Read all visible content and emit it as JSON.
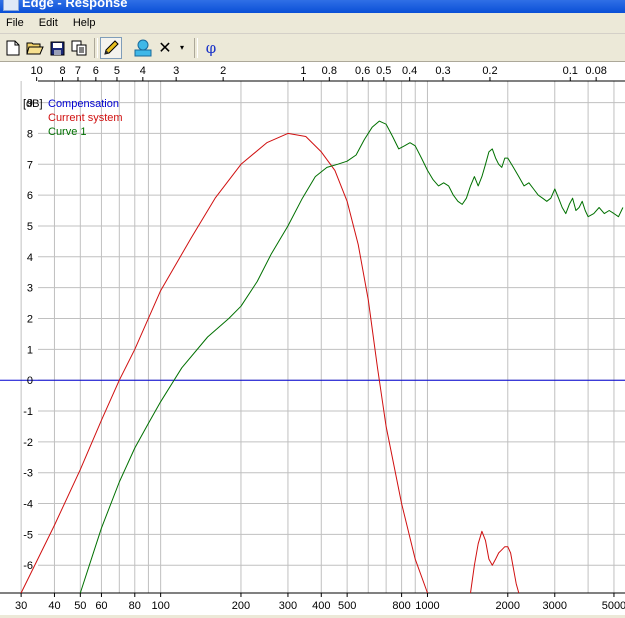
{
  "window": {
    "title": "Edge - Response"
  },
  "menu": {
    "file": "File",
    "edit": "Edit",
    "help": "Help"
  },
  "toolbar": {
    "new": "new-document-icon",
    "open": "open-folder-icon",
    "save": "save-disk-icon",
    "copy": "copy-icon",
    "pen": "pen-icon",
    "stamp": "stamp-icon",
    "delete_symbol": "✕",
    "dropdown_symbol": "▾",
    "phase_symbol": "φ"
  },
  "colors": {
    "compensation": "#0000d0",
    "current_system": "#d01010",
    "curve1": "#007000",
    "grid": "#c0c0c0"
  },
  "chart_data": {
    "type": "line",
    "x_scale": "log",
    "xlim": [
      25,
      5500
    ],
    "ylim": [
      -6.9,
      9.7
    ],
    "ylabel": "[dB]",
    "y_ticks": [
      9,
      8,
      7,
      6,
      5,
      4,
      3,
      2,
      1,
      0,
      -1,
      -2,
      -3,
      -4,
      -5,
      -6
    ],
    "x_ticks_bottom": [
      30,
      40,
      50,
      60,
      80,
      100,
      200,
      300,
      400,
      500,
      800,
      1000,
      2000,
      3000,
      5000
    ],
    "x_tick_labels_bottom": [
      "30",
      "40",
      "50",
      "60",
      "80",
      "100",
      "200",
      "300",
      "400",
      "500",
      "800",
      "1000",
      "2000",
      "3000",
      "5000"
    ],
    "top_axis_unit": "wavelength (m)",
    "top_ticks": [
      10,
      8,
      7,
      6,
      5,
      4,
      3,
      2,
      1,
      0.8,
      0.6,
      0.5,
      0.4,
      0.3,
      0.2,
      0.1,
      0.08
    ],
    "top_tick_labels": [
      "10",
      "8",
      "7",
      "6",
      "5",
      "4",
      "3",
      "2",
      "1",
      "0.8",
      "0.6",
      "0.5",
      "0.4",
      "0.3",
      "0.2",
      "0.1",
      "0.08"
    ],
    "series": [
      {
        "name": "Compensation",
        "color": "#0000d0",
        "x": [
          25,
          5500
        ],
        "y": [
          0,
          0
        ]
      },
      {
        "name": "Current system",
        "color": "#d01010",
        "x": [
          30,
          40,
          50,
          60,
          70,
          80,
          100,
          130,
          160,
          200,
          250,
          300,
          350,
          400,
          450,
          500,
          550,
          600,
          650,
          700,
          800,
          900,
          1000
        ],
        "y": [
          -7,
          -4.7,
          -2.9,
          -1.3,
          0,
          1.0,
          2.9,
          4.6,
          5.9,
          7.0,
          7.7,
          8.0,
          7.9,
          7.4,
          6.8,
          5.8,
          4.4,
          2.6,
          0.4,
          -1.5,
          -4.0,
          -5.8,
          -7
        ]
      },
      {
        "name": "Current system",
        "color": "#d01010",
        "x": [
          1450,
          1500,
          1550,
          1600,
          1650,
          1700,
          1750,
          1800,
          1850,
          1900,
          1950,
          2000,
          2050,
          2100,
          2150,
          2200
        ],
        "y": [
          -7,
          -6.0,
          -5.3,
          -4.9,
          -5.2,
          -5.8,
          -6.0,
          -5.8,
          -5.6,
          -5.5,
          -5.4,
          -5.4,
          -5.6,
          -6.1,
          -6.6,
          -7
        ]
      },
      {
        "name": "Curve 1",
        "color": "#007000",
        "x": [
          50,
          60,
          70,
          80,
          90,
          100,
          120,
          150,
          180,
          200,
          230,
          260,
          300,
          340,
          380,
          420,
          460,
          500,
          540,
          580,
          620,
          660,
          700,
          740,
          780,
          820,
          860,
          900,
          950,
          1000,
          1050,
          1100,
          1150,
          1200,
          1250,
          1300,
          1350,
          1400,
          1450,
          1500,
          1550,
          1600,
          1650,
          1700,
          1750,
          1800,
          1850,
          1900,
          1950,
          2000,
          2100,
          2200,
          2300,
          2400,
          2500,
          2600,
          2700,
          2800,
          2900,
          3000,
          3100,
          3200,
          3300,
          3400,
          3500,
          3600,
          3700,
          3800,
          3900,
          4000,
          4200,
          4400,
          4600,
          4800,
          5000,
          5200,
          5400
        ],
        "y": [
          -7,
          -4.8,
          -3.3,
          -2.2,
          -1.4,
          -0.7,
          0.4,
          1.4,
          2.0,
          2.4,
          3.2,
          4.1,
          5.0,
          5.9,
          6.6,
          6.9,
          7.0,
          7.1,
          7.3,
          7.8,
          8.2,
          8.4,
          8.3,
          7.9,
          7.5,
          7.6,
          7.7,
          7.6,
          7.2,
          6.8,
          6.5,
          6.3,
          6.4,
          6.3,
          6.0,
          5.8,
          5.7,
          5.9,
          6.3,
          6.6,
          6.3,
          6.6,
          7.0,
          7.4,
          7.5,
          7.2,
          7.0,
          6.9,
          7.2,
          7.2,
          6.9,
          6.6,
          6.3,
          6.4,
          6.2,
          6.0,
          5.9,
          5.8,
          5.9,
          6.2,
          5.9,
          5.6,
          5.4,
          5.7,
          5.9,
          5.5,
          5.6,
          5.8,
          5.5,
          5.3,
          5.4,
          5.6,
          5.4,
          5.5,
          5.4,
          5.3,
          5.6
        ]
      }
    ]
  }
}
